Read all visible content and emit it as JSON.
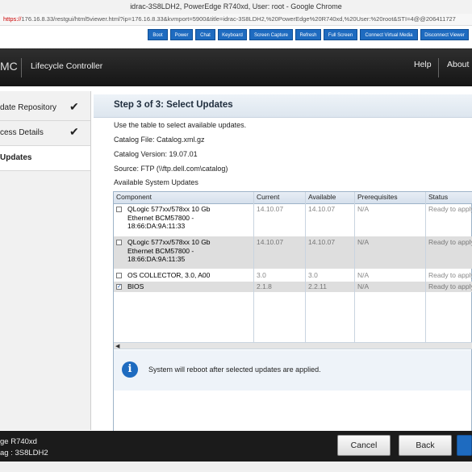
{
  "browser": {
    "title": "idrac-3S8LDH2, PowerEdge R740xd, User: root - Google Chrome",
    "url_scheme": "https://",
    "url_rest": "176.16.8.33/restgui/html5viewer.html?ip=176.16.8.33&kvmport=5900&title=idrac-3S8LDH2,%20PowerEdge%20R740xd,%20User:%20root&STI=4@@206411727"
  },
  "toolbar": {
    "buttons": [
      "Boot",
      "Power",
      "Chat",
      "Keyboard",
      "Screen Capture",
      "Refresh",
      "Full Screen",
      "Connect Virtual Media",
      "Disconnect Viewer"
    ]
  },
  "header": {
    "brand": "MC",
    "app_name": "Lifecycle Controller",
    "help": "Help",
    "about": "About"
  },
  "sidebar": {
    "items": [
      {
        "label": "date Repository",
        "done": true
      },
      {
        "label": "cess Details",
        "done": true
      },
      {
        "label": "Updates",
        "done": false
      }
    ],
    "check_glyph": "✔"
  },
  "main": {
    "step_title": "Step 3 of 3: Select Updates",
    "instruction": "Use the table to select available updates.",
    "catalog_file": "Catalog File: Catalog.xml.gz",
    "catalog_version": "Catalog Version: 19.07.01",
    "source": "Source: FTP (\\\\ftp.dell.com\\catalog)",
    "section_label": "Available System Updates"
  },
  "table": {
    "headers": [
      "Component",
      "Current",
      "Available",
      "Prerequisites",
      "Status"
    ],
    "rows": [
      {
        "checked": false,
        "component": [
          "QLogic 577xx/578xx 10 Gb",
          "Ethernet BCM57800 -",
          "18:66:DA:9A:11:33"
        ],
        "current": "14.10.07",
        "available": "14.10.07",
        "prereq": "N/A",
        "status": "Ready to apply"
      },
      {
        "checked": false,
        "component": [
          "QLogic 577xx/578xx 10 Gb",
          "Ethernet BCM57800 -",
          "18:66:DA:9A:11:35"
        ],
        "current": "14.10.07",
        "available": "14.10.07",
        "prereq": "N/A",
        "status": "Ready to apply"
      },
      {
        "checked": false,
        "component": [
          "OS COLLECTOR, 3.0, A00"
        ],
        "current": "3.0",
        "available": "3.0",
        "prereq": "N/A",
        "status": "Ready to apply"
      },
      {
        "checked": true,
        "component": [
          "BIOS"
        ],
        "current": "2.1.8",
        "available": "2.2.11",
        "prereq": "N/A",
        "status": "Ready to apply"
      }
    ],
    "scroll_arrow": "◀"
  },
  "notice": {
    "icon": "i",
    "message": "System will reboot after selected updates are applied."
  },
  "footer": {
    "model": "ge R740xd",
    "service_tag": "ag : 3S8LDH2",
    "cancel": "Cancel",
    "back": "Back"
  }
}
